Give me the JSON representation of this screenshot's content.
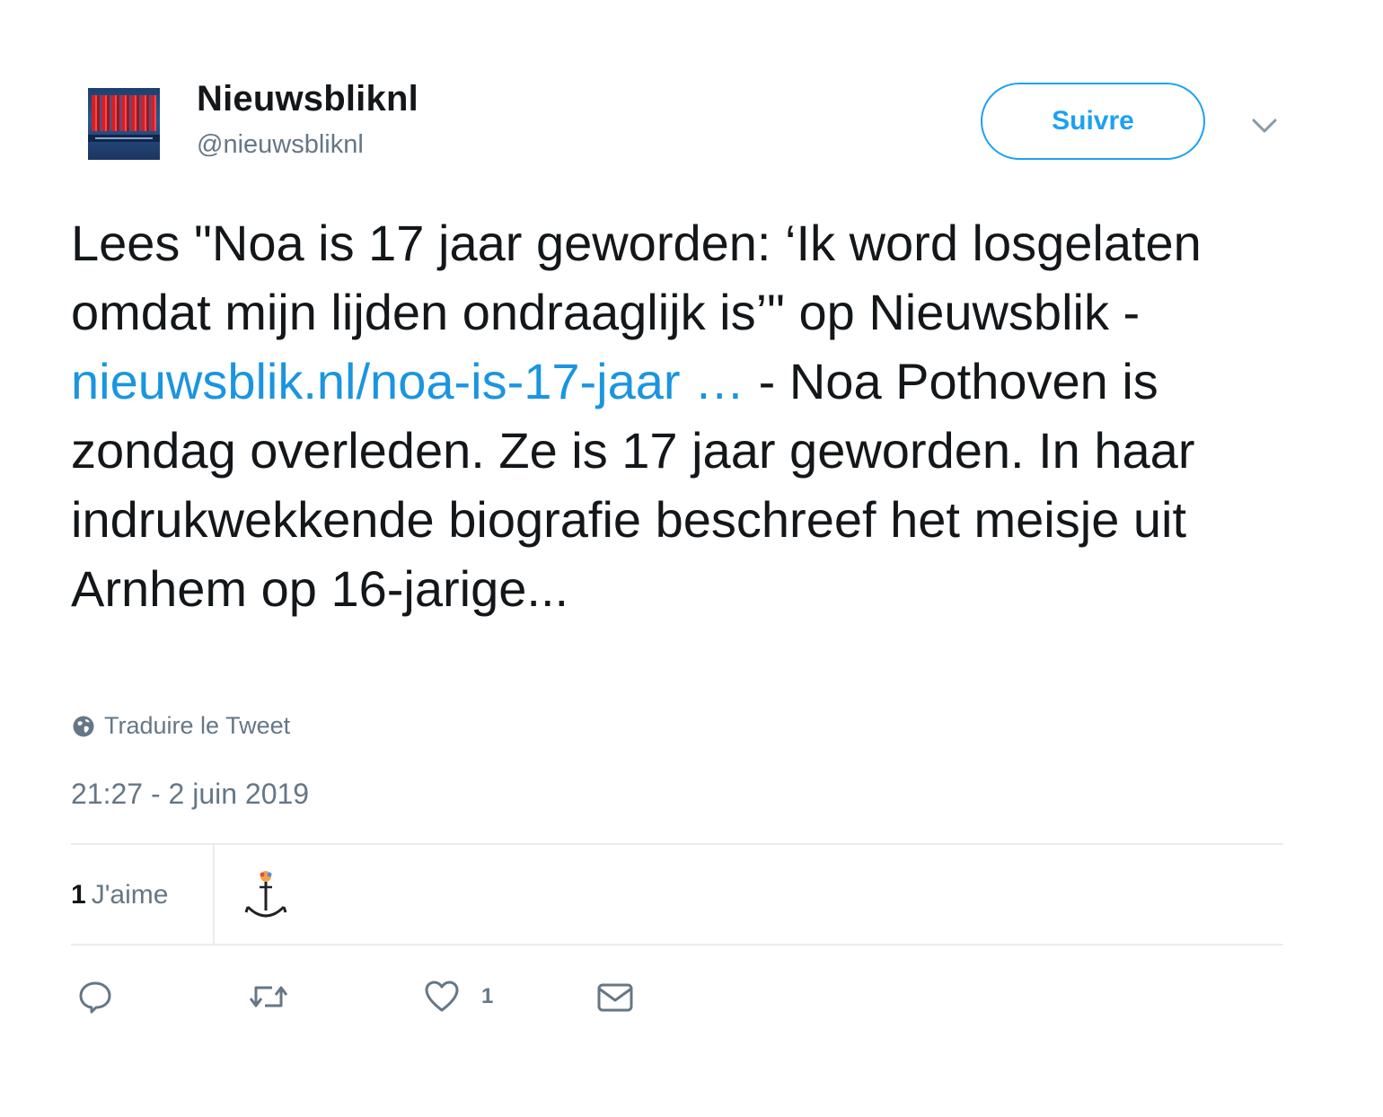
{
  "author": {
    "name": "Nieuwsbliknl",
    "handle": "@nieuwsbliknl",
    "avatar_icon": "nieuwsblik-logo-avatar"
  },
  "header": {
    "follow_label": "Suivre",
    "menu_icon": "chevron-down-icon"
  },
  "tweet": {
    "text_before_link": "Lees \"Noa is 17 jaar geworden: ‘Ik word losgelaten omdat mijn lijden ondraaglijk is’\" op Nieuwsblik - ",
    "link_text": "nieuwsblik.nl/noa-is-17-jaar …",
    "text_after_link": " - Noa Pothoven is zondag overleden. Ze is 17 jaar geworden. In haar indrukwekkende biografie beschreef het meisje uit Arnhem op 16-jarige...",
    "translate_label": "Traduire le Tweet",
    "timestamp": "21:27 - 2 juin 2019"
  },
  "stats": {
    "likes_count": "1",
    "likes_label": "J'aime"
  },
  "actions": {
    "reply_icon": "reply-icon",
    "retweet_icon": "retweet-icon",
    "like_icon": "heart-icon",
    "like_count": "1",
    "dm_icon": "envelope-icon"
  },
  "colors": {
    "accent": "#1da1f2",
    "link": "#1b95e0",
    "text": "#14171a",
    "secondary": "#657786",
    "divider": "#e6ecf0"
  }
}
